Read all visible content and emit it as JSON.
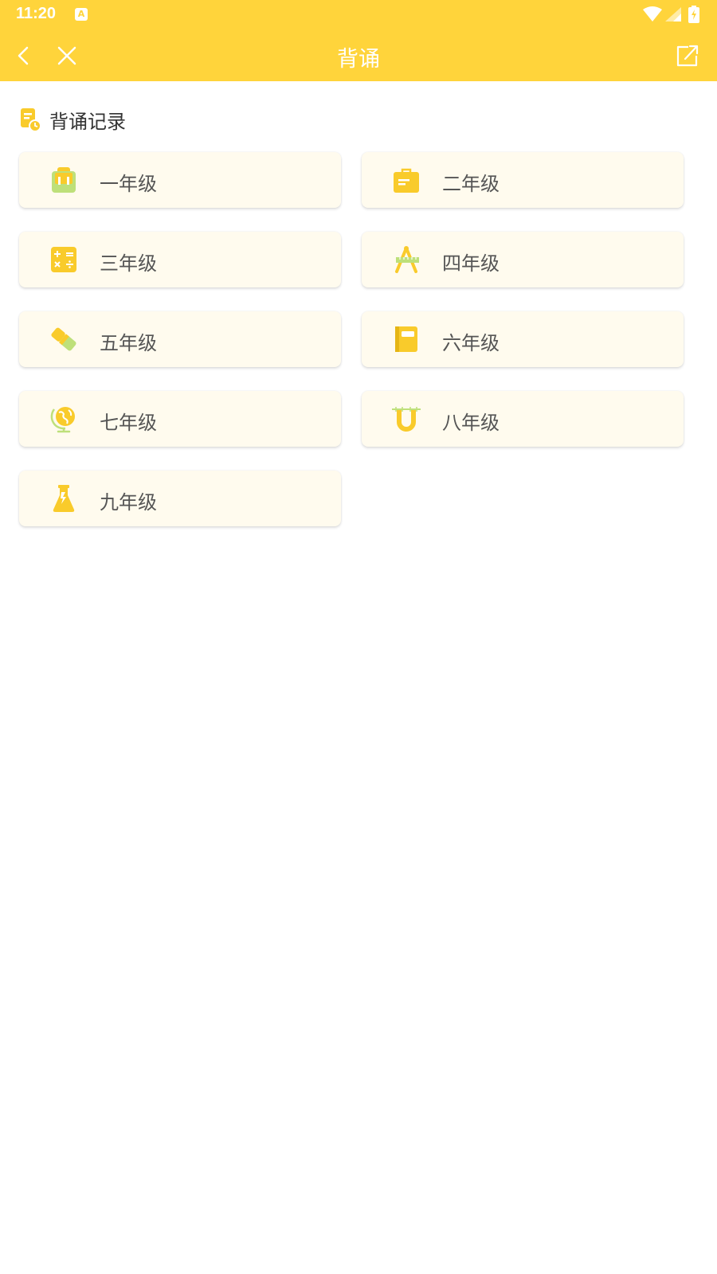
{
  "status_bar": {
    "time": "11:20",
    "notification_icon": "a-icon",
    "notification_glyph": "A",
    "icons": [
      "wifi-icon",
      "signal-icon",
      "battery-icon"
    ]
  },
  "navbar": {
    "title": "背诵",
    "back_icon": "chevron-left-icon",
    "close_icon": "close-icon",
    "share_icon": "share-icon"
  },
  "record": {
    "label": "背诵记录",
    "icon": "record-doc-icon"
  },
  "grades": [
    {
      "label": "一年级",
      "icon": "backpack-icon"
    },
    {
      "label": "二年级",
      "icon": "briefcase-icon"
    },
    {
      "label": "三年级",
      "icon": "calculator-icon"
    },
    {
      "label": "四年级",
      "icon": "compass-ruler-icon"
    },
    {
      "label": "五年级",
      "icon": "eraser-icon"
    },
    {
      "label": "六年级",
      "icon": "notebook-icon"
    },
    {
      "label": "七年级",
      "icon": "globe-icon"
    },
    {
      "label": "八年级",
      "icon": "magnet-icon"
    },
    {
      "label": "九年级",
      "icon": "flask-icon"
    }
  ],
  "colors": {
    "accent": "#FFD43B",
    "card_background": "#FFFBEE",
    "icon_yellow": "#F9CB2B",
    "icon_green": "#BEE07A"
  }
}
